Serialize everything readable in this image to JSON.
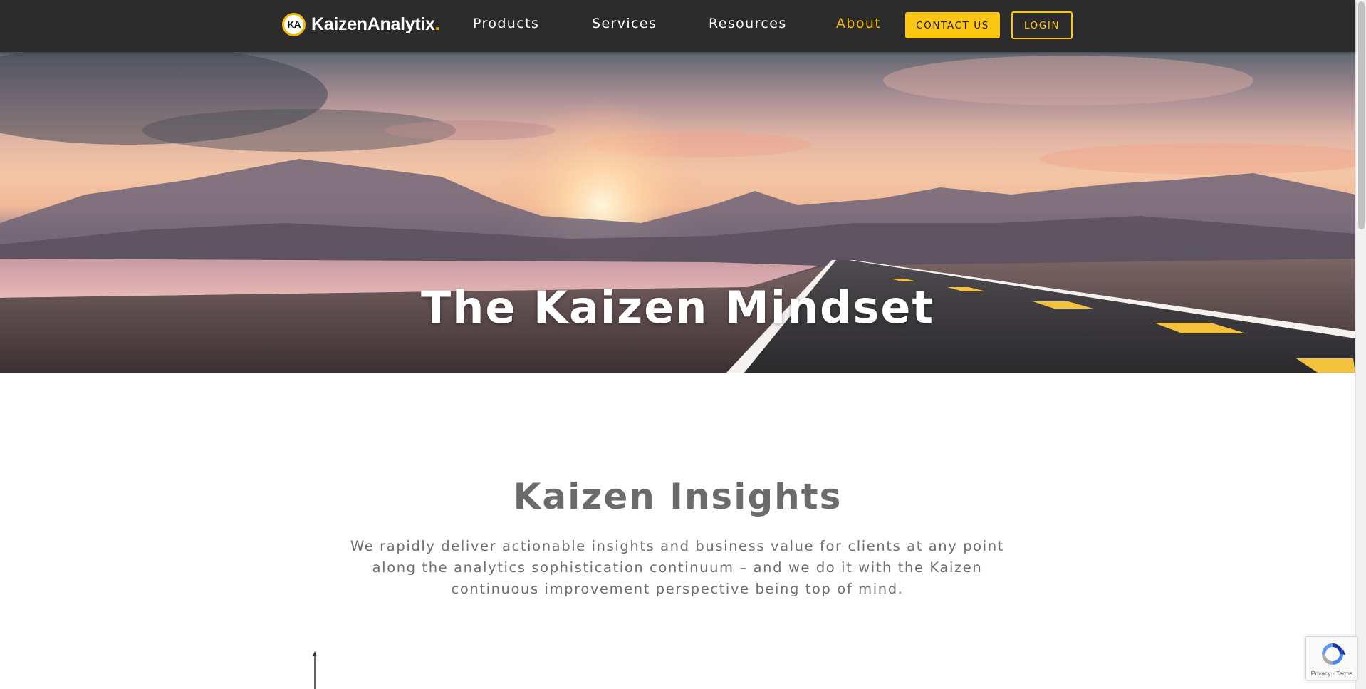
{
  "nav": {
    "logo_text": "KaizenAnalytix",
    "logo_dot": ".",
    "logo_mark": "KA",
    "links": [
      {
        "label": "Products"
      },
      {
        "label": "Services"
      },
      {
        "label": "Resources"
      },
      {
        "label": "About",
        "active": true
      }
    ],
    "contact_label": "CONTACT US",
    "login_label": "LOGIN"
  },
  "hero": {
    "title": "The Kaizen Mindset"
  },
  "insights": {
    "title": "Kaizen Insights",
    "body": "We rapidly deliver actionable insights and business value for clients at any point along the analytics sophistication continuum – and we do it with the Kaizen continuous improvement perspective being top of mind."
  },
  "recaptcha": {
    "links": "Privacy - Terms",
    "icon": "recaptcha-icon"
  },
  "colors": {
    "nav_bg": "#2b2b2b",
    "accent": "#fcc713",
    "heading_gray": "#6b6b6b"
  }
}
